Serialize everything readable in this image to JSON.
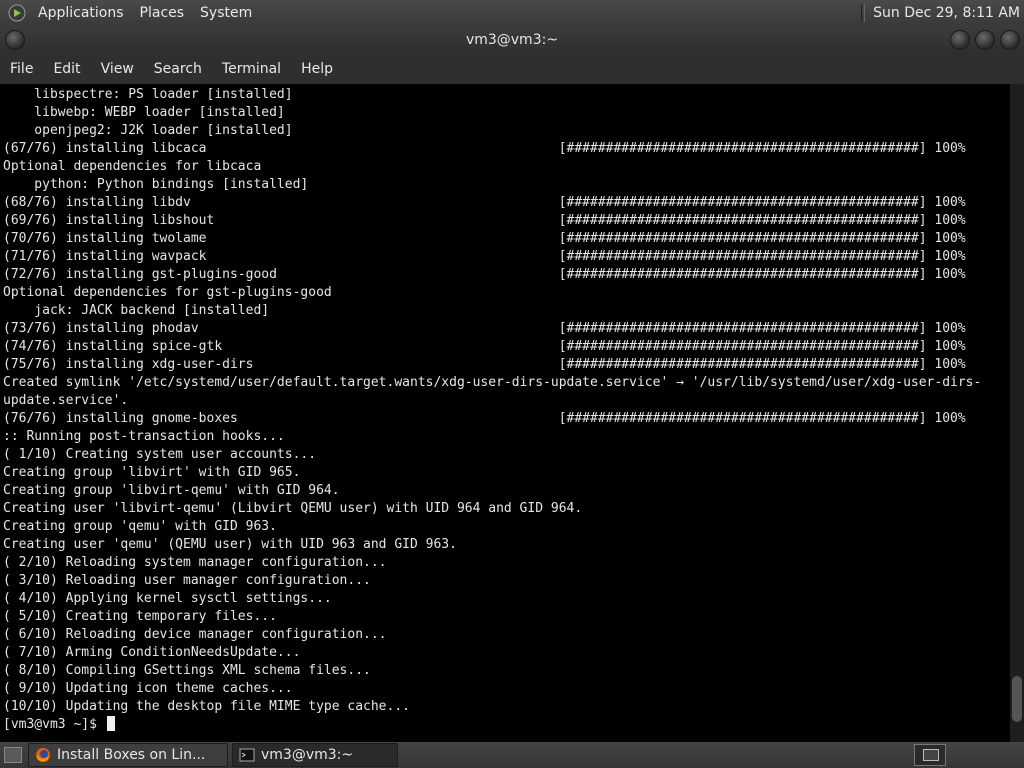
{
  "top_panel": {
    "menus": [
      "Applications",
      "Places",
      "System"
    ],
    "clock": "Sun Dec 29,  8:11 AM"
  },
  "window": {
    "title": "vm3@vm3:~"
  },
  "menubar": {
    "items": [
      "File",
      "Edit",
      "View",
      "Search",
      "Terminal",
      "Help"
    ]
  },
  "terminal": {
    "lines": [
      "    libspectre: PS loader [installed]",
      "    libwebp: WEBP loader [installed]",
      "    openjpeg2: J2K loader [installed]",
      "(67/76) installing libcaca                                             [#############################################] 100%",
      "Optional dependencies for libcaca",
      "    python: Python bindings [installed]",
      "(68/76) installing libdv                                               [#############################################] 100%",
      "(69/76) installing libshout                                            [#############################################] 100%",
      "(70/76) installing twolame                                             [#############################################] 100%",
      "(71/76) installing wavpack                                             [#############################################] 100%",
      "(72/76) installing gst-plugins-good                                    [#############################################] 100%",
      "Optional dependencies for gst-plugins-good",
      "    jack: JACK backend [installed]",
      "(73/76) installing phodav                                              [#############################################] 100%",
      "(74/76) installing spice-gtk                                           [#############################################] 100%",
      "(75/76) installing xdg-user-dirs                                       [#############################################] 100%",
      "Created symlink '/etc/systemd/user/default.target.wants/xdg-user-dirs-update.service' → '/usr/lib/systemd/user/xdg-user-dirs-",
      "update.service'.",
      "(76/76) installing gnome-boxes                                         [#############################################] 100%",
      ":: Running post-transaction hooks...",
      "( 1/10) Creating system user accounts...",
      "Creating group 'libvirt' with GID 965.",
      "Creating group 'libvirt-qemu' with GID 964.",
      "Creating user 'libvirt-qemu' (Libvirt QEMU user) with UID 964 and GID 964.",
      "Creating group 'qemu' with GID 963.",
      "Creating user 'qemu' (QEMU user) with UID 963 and GID 963.",
      "( 2/10) Reloading system manager configuration...",
      "( 3/10) Reloading user manager configuration...",
      "( 4/10) Applying kernel sysctl settings...",
      "( 5/10) Creating temporary files...",
      "( 6/10) Reloading device manager configuration...",
      "( 7/10) Arming ConditionNeedsUpdate...",
      "( 8/10) Compiling GSettings XML schema files...",
      "( 9/10) Updating icon theme caches...",
      "(10/10) Updating the desktop file MIME type cache..."
    ],
    "prompt": "[vm3@vm3 ~]$ "
  },
  "taskbar": {
    "tasks": [
      {
        "label": "Install Boxes on Lin...",
        "icon": "firefox-icon"
      },
      {
        "label": "vm3@vm3:~",
        "icon": "terminal-icon"
      }
    ]
  }
}
